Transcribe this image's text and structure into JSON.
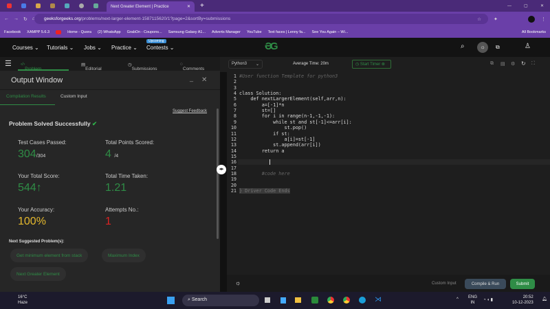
{
  "browser": {
    "active_tab": "Next Greater Element | Practice",
    "url_domain": "geeksforgeeks.org",
    "url_path": "/problems/next-larger-element-1587115620/1?page=2&sortBy=submissions",
    "bookmarks": [
      "Facebook",
      "XAMPP 5.6.3",
      "",
      "Home - Quora",
      "(2) WhatsApp",
      "GrabOn - Coupons...",
      "Samsung Galaxy A1...",
      "Adverts Manager",
      "YouTube",
      "Text faces | Lenny fa...",
      "See You Again – Wi..."
    ],
    "all_bookmarks": "All Bookmarks"
  },
  "nav": {
    "items": [
      "Courses",
      "Tutorials",
      "Jobs",
      "Practice",
      "Contests"
    ],
    "badge": "Upcoming",
    "logo": "GfG"
  },
  "problem_tabs": [
    "Problem",
    "Editorial",
    "Submissions",
    "Comments"
  ],
  "output": {
    "title": "Output Window",
    "tabs": [
      "Compilation Results",
      "Custom Input"
    ],
    "suggest_feedback": "Suggest Feedback",
    "status": "Problem Solved Successfully",
    "stats": {
      "tc_label": "Test Cases Passed:",
      "tc_value": "304",
      "tc_total": "/304",
      "pts_label": "Total Points Scored:",
      "pts_value": "4",
      "pts_total": "/4",
      "score_label": "Your Total Score:",
      "score_value": "544",
      "time_label": "Total Time Taken:",
      "time_value": "1.21",
      "acc_label": "Your Accuracy:",
      "acc_value": "100%",
      "att_label": "Attempts No.:",
      "att_value": "1"
    },
    "next_label": "Next Suggested Problem(s):",
    "suggestions": [
      "Get minimum element from stack",
      "Maximum Index",
      "Next Greater Element"
    ]
  },
  "editor": {
    "language": "Python3",
    "avg_time": "Average Time: 20m",
    "start_timer": "Start Timer",
    "lines": [
      "#User function Template for python3",
      "",
      "",
      "class Solution:",
      "    def nextLargerElement(self,arr,n):",
      "        a=[-1]*n",
      "        st=[]",
      "        for i in range(n-1,-1,-1):",
      "            while st and st[-1]<=arr[i]:",
      "                st.pop()",
      "            if st:",
      "                a[i]=st[-1]",
      "            st.append(arr[i])",
      "        return a",
      "",
      "",
      "",
      "        #code here",
      "",
      "",
      "} Driver Code Ends"
    ],
    "custom_input": "Custom Input",
    "compile": "Compile & Run",
    "submit": "Submit"
  },
  "taskbar": {
    "temp": "16°C",
    "weather": "Haze",
    "search": "Search",
    "lang1": "ENG",
    "lang2": "IN",
    "time": "20:52",
    "date": "10-12-2023"
  }
}
